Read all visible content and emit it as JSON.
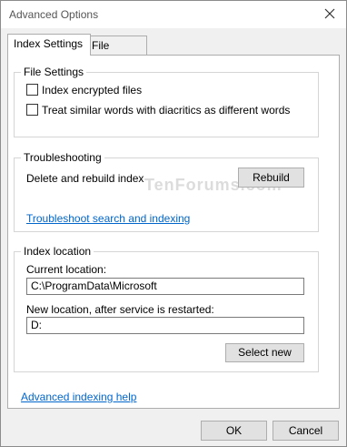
{
  "window": {
    "title": "Advanced Options"
  },
  "tabs": [
    {
      "label": "Index Settings",
      "active": true
    },
    {
      "label": "File Types",
      "active": false
    }
  ],
  "file_settings": {
    "legend": "File Settings",
    "checkboxes": [
      {
        "label": "Index encrypted files",
        "checked": false
      },
      {
        "label": "Treat similar words with diacritics as different words",
        "checked": false
      }
    ]
  },
  "troubleshooting": {
    "legend": "Troubleshooting",
    "rebuild_text": "Delete and rebuild index",
    "rebuild_label": "Rebuild",
    "troubleshoot_link": "Troubleshoot search and indexing"
  },
  "index_location": {
    "legend": "Index location",
    "current_label": "Current location:",
    "current_value": "C:\\ProgramData\\Microsoft",
    "new_label": "New location, after service is restarted:",
    "new_value": "D:",
    "select_new_label": "Select new"
  },
  "footer": {
    "help_link": "Advanced indexing help",
    "ok_label": "OK",
    "cancel_label": "Cancel"
  },
  "watermark": "TenForums.com",
  "icons": {
    "close": "close-icon"
  },
  "colors": {
    "link": "#0066cc",
    "panel_bg": "#ffffff",
    "window_bg": "#f0f0f0"
  }
}
